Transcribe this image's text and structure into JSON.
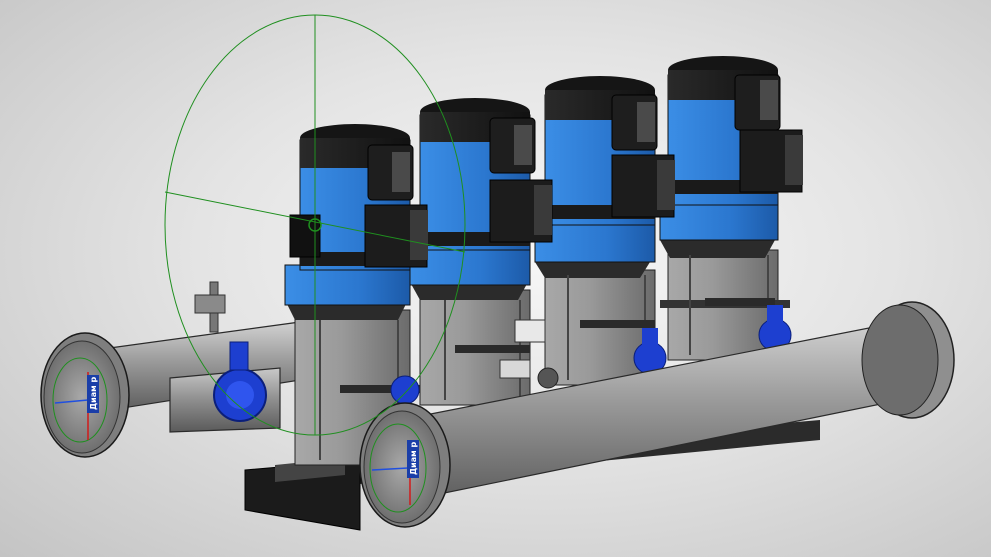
{
  "viewport": {
    "background": "#e6e6e6",
    "scene_name": "pump-booster-station-3d"
  },
  "model": {
    "pump_count": 4,
    "pump_colors": {
      "motor_top": "#1c1c1c",
      "casing": "#2f7fd9",
      "body": "#8c8c8c",
      "valve": "#1d3fd0"
    },
    "pipe_color": "#8a8a8a",
    "gizmo_color": "#1f8f1f"
  },
  "connectors": {
    "inlet_label": "Диам р",
    "outlet_label": "Диам р"
  }
}
